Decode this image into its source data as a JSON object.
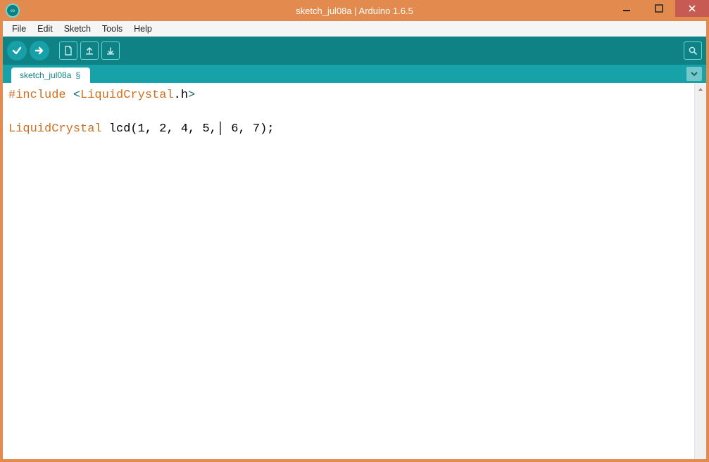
{
  "window": {
    "title": "sketch_jul08a | Arduino 1.6.5"
  },
  "menubar": {
    "items": [
      "File",
      "Edit",
      "Sketch",
      "Tools",
      "Help"
    ]
  },
  "toolbar": {
    "verify": "verify",
    "upload": "upload",
    "new": "new",
    "open": "open",
    "save": "save",
    "serial": "serial-monitor"
  },
  "tabs": {
    "active": {
      "label": "sketch_jul08a",
      "modified_marker": "§"
    }
  },
  "code": {
    "line1_include": "#include",
    "line1_lt": "<",
    "line1_header": "LiquidCrystal",
    "line1_dot_h": ".h",
    "line1_gt": ">",
    "line3_type": "LiquidCrystal",
    "line3_rest_a": " lcd(1, 2, 4, 5,",
    "line3_rest_b": " 6, 7);"
  },
  "colors": {
    "accent_orange": "#e38b4f",
    "teal_dark": "#0f8285",
    "teal_light": "#17a1a8",
    "close_red": "#c75a52"
  }
}
